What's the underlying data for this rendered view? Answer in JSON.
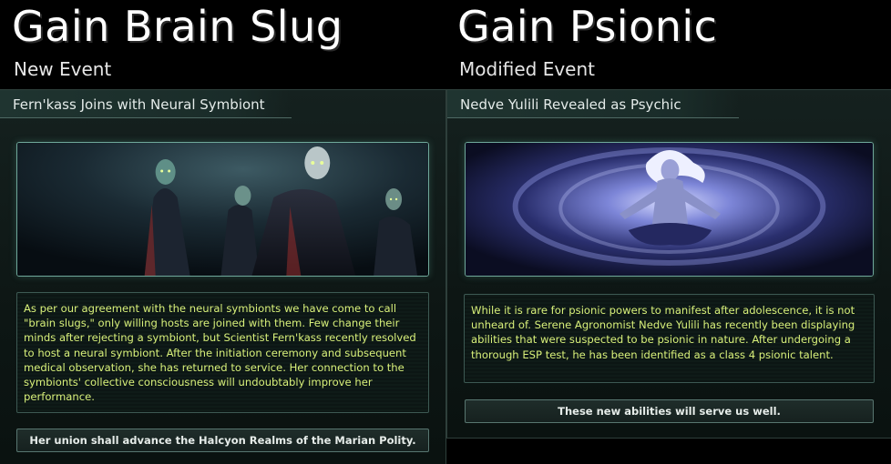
{
  "left_event": {
    "title": "Gain Brain Slug",
    "subtitle": "New Event",
    "event_name": "Fern'kass Joins with Neural Symbiont",
    "illustration": "alien-figures-with-brain-slugs",
    "description": "As per our agreement with the neural symbionts we have come to call \"brain slugs,\" only willing hosts are joined with them. Few change their minds after rejecting a symbiont, but Scientist Fern'kass recently resolved to host a neural symbiont. After the initiation ceremony and subsequent medical observation, she has returned to service. Her connection to the symbionts' collective consciousness will undoubtably improve her performance.",
    "option": "Her union shall advance the Halcyon Realms of the Marian Polity."
  },
  "right_event": {
    "title": "Gain Psionic",
    "subtitle": "Modified Event",
    "event_name": "Nedve Yulili Revealed as Psychic",
    "illustration": "meditating-psionic-figure",
    "description": "While it is rare for psionic powers to manifest after adolescence, it is not unheard of. Serene Agronomist Nedve Yulili has recently been displaying abilities that were suspected to be psionic in nature.  After undergoing a thorough ESP test, he has been identified as a class 4 psionic talent.",
    "option": "These new abilities will serve us well."
  },
  "colors": {
    "description_text": "#d8f07a",
    "frame_accent": "#6fa89a",
    "background": "#0d1614"
  }
}
